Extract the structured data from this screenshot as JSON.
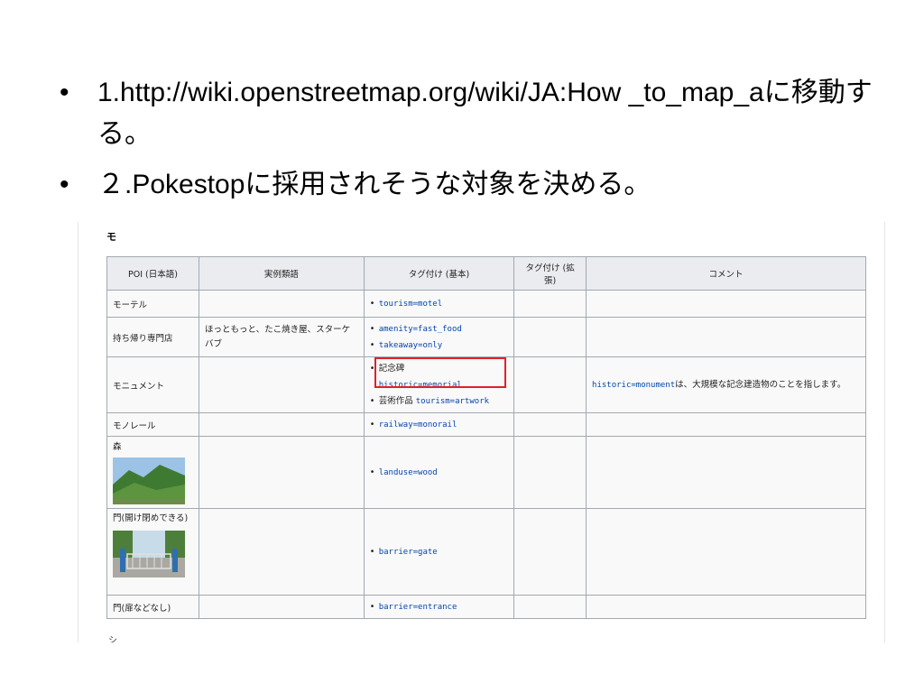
{
  "slide": {
    "bullet_glyph": "•",
    "bullets": [
      {
        "text": "1.http://wiki.openstreetmap.org/wiki/JA:How _to_map_aに移動する。"
      },
      {
        "text": "２.Pokestopに採用されそうな対象を決める。"
      }
    ]
  },
  "screenshot": {
    "section_heading": "モ",
    "table": {
      "headers": [
        "POI (日本語)",
        "実例類語",
        "タグ付け (基本)",
        "タグ付け (拡張)",
        "コメント"
      ],
      "rows": [
        {
          "poi": "モーテル",
          "examples": "",
          "tags": [
            "tourism=motel"
          ],
          "comment": ""
        },
        {
          "poi": "持ち帰り専門店",
          "examples": "ほっともっと、たこ焼き屋、スターケバブ",
          "tags": [
            "amenity=fast_food",
            "takeaway=only"
          ],
          "comment": ""
        },
        {
          "poi": "モニュメント",
          "examples": "",
          "tags_label_1": "記念碑",
          "tag_1": "historic=memorial",
          "tags_label_2": "芸術作品",
          "tag_2": "tourism=artwork",
          "comment_tag": "historic=monument",
          "comment": "は、大規模な記念建造物のことを指します。"
        },
        {
          "poi": "モノレール",
          "examples": "",
          "tags": [
            "railway=monorail"
          ],
          "comment": ""
        },
        {
          "poi": "森",
          "examples": "",
          "tags": [
            "landuse=wood"
          ],
          "comment": "",
          "image": "forest-photo"
        },
        {
          "poi": "門(開け閉めできる)",
          "examples": "",
          "tags": [
            "barrier=gate"
          ],
          "comment": "",
          "image": "gate-photo"
        },
        {
          "poi": "門(扉などなし)",
          "examples": "",
          "tags": [
            "barrier=entrance"
          ],
          "comment": ""
        }
      ]
    },
    "footer_fragment": "シ"
  },
  "colors": {
    "highlight_box": "#e0202a",
    "link_blue": "#0645ad",
    "table_border": "#a2a9b1",
    "header_bg": "#eaecf0"
  }
}
